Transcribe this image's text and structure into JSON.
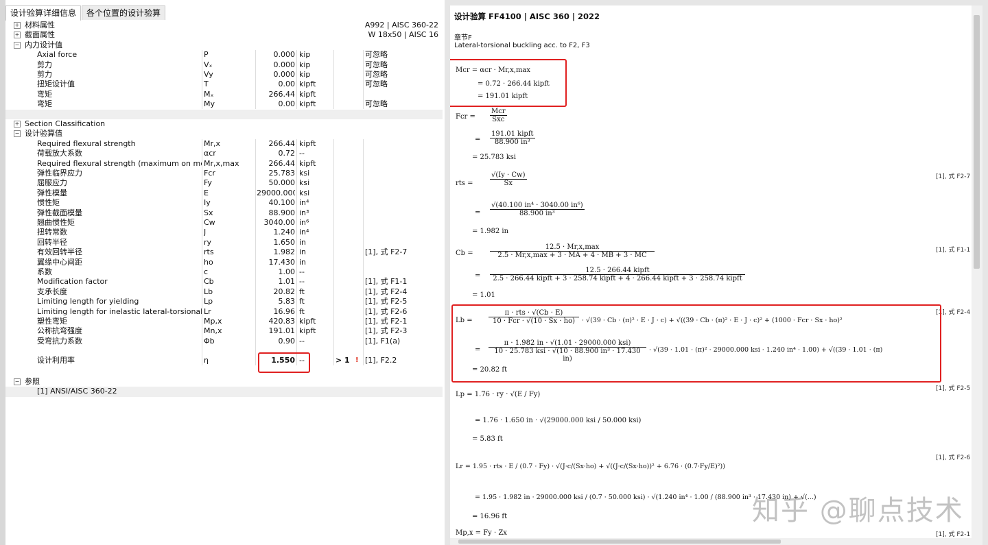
{
  "tabs": [
    "设计验算详细信息",
    "各个位置的设计验算"
  ],
  "tree": {
    "material": {
      "label": "材料属性",
      "value": "A992 | AISC 360-22"
    },
    "section": {
      "label": "截面属性",
      "value": "W 18x50 | AISC 16"
    },
    "internal": {
      "label": "内力设计值",
      "rows": [
        {
          "name": "Axial force",
          "sym": "P",
          "val": "0.000",
          "unit": "kip",
          "ref": "可忽略"
        },
        {
          "name": "剪力",
          "sym": "Vₓ",
          "val": "0.000",
          "unit": "kip",
          "ref": "可忽略"
        },
        {
          "name": "剪力",
          "sym": "Vy",
          "val": "0.000",
          "unit": "kip",
          "ref": "可忽略"
        },
        {
          "name": "扭矩设计值",
          "sym": "T",
          "val": "0.00",
          "unit": "kipft",
          "ref": "可忽略"
        },
        {
          "name": "弯矩",
          "sym": "Mₓ",
          "val": "266.44",
          "unit": "kipft",
          "ref": ""
        },
        {
          "name": "弯矩",
          "sym": "My",
          "val": "0.00",
          "unit": "kipft",
          "ref": "可忽略"
        }
      ]
    },
    "section_class": {
      "label": "Section Classification"
    },
    "design": {
      "label": "设计验算值",
      "rows": [
        {
          "name": "Required flexural strength",
          "sym": "Mr,x",
          "val": "266.44",
          "unit": "kipft",
          "ref": ""
        },
        {
          "name": "荷载放大系数",
          "sym": "αcr",
          "val": "0.72",
          "unit": "--",
          "ref": ""
        },
        {
          "name": "Required flexural strength (maximum on memb...",
          "sym": "Mr,x,max",
          "val": "266.44",
          "unit": "kipft",
          "ref": ""
        },
        {
          "name": "弹性临界应力",
          "sym": "Fcr",
          "val": "25.783",
          "unit": "ksi",
          "ref": ""
        },
        {
          "name": "屈服应力",
          "sym": "Fy",
          "val": "50.000",
          "unit": "ksi",
          "ref": ""
        },
        {
          "name": "弹性模量",
          "sym": "E",
          "val": "29000.000",
          "unit": "ksi",
          "ref": ""
        },
        {
          "name": "惯性矩",
          "sym": "Iy",
          "val": "40.100",
          "unit": "in⁴",
          "ref": ""
        },
        {
          "name": "弹性截面模量",
          "sym": "Sx",
          "val": "88.900",
          "unit": "in³",
          "ref": ""
        },
        {
          "name": "翘曲惯性矩",
          "sym": "Cw",
          "val": "3040.00",
          "unit": "in⁶",
          "ref": ""
        },
        {
          "name": "扭转常数",
          "sym": "J",
          "val": "1.240",
          "unit": "in⁴",
          "ref": ""
        },
        {
          "name": "回转半径",
          "sym": "ry",
          "val": "1.650",
          "unit": "in",
          "ref": ""
        },
        {
          "name": "有效回转半径",
          "sym": "rts",
          "val": "1.982",
          "unit": "in",
          "ref": "[1], 式 F2-7"
        },
        {
          "name": "翼缘中心间距",
          "sym": "ho",
          "val": "17.430",
          "unit": "in",
          "ref": ""
        },
        {
          "name": "系数",
          "sym": "c",
          "val": "1.00",
          "unit": "--",
          "ref": ""
        },
        {
          "name": "Modification factor",
          "sym": "Cb",
          "val": "1.01",
          "unit": "--",
          "ref": "[1], 式 F1-1"
        },
        {
          "name": "支承长度",
          "sym": "Lb",
          "val": "20.82",
          "unit": "ft",
          "ref": "[1], 式 F2-4"
        },
        {
          "name": "Limiting length for yielding",
          "sym": "Lp",
          "val": "5.83",
          "unit": "ft",
          "ref": "[1], 式 F2-5"
        },
        {
          "name": "Limiting length for inelastic lateral-torsional bu...",
          "sym": "Lr",
          "val": "16.96",
          "unit": "ft",
          "ref": "[1], 式 F2-6"
        },
        {
          "name": "塑性弯矩",
          "sym": "Mp,x",
          "val": "420.83",
          "unit": "kipft",
          "ref": "[1], 式 F2-1"
        },
        {
          "name": "公称抗弯强度",
          "sym": "Mn,x",
          "val": "191.01",
          "unit": "kipft",
          "ref": "[1], 式 F2-3"
        },
        {
          "name": "受弯抗力系数",
          "sym": "Φb",
          "val": "0.90",
          "unit": "--",
          "ref": "[1], F1(a)"
        }
      ]
    },
    "ratio": {
      "name": "设计利用率",
      "sym": "η",
      "val": "1.550",
      "unit": "--",
      "cmp": "> 1",
      "ref": "[1], F2.2"
    },
    "refs": {
      "label": "参照",
      "item": "[1]  ANSI/AISC 360-22"
    }
  },
  "report": {
    "title": "设计验算 FF4100 | AISC 360 | 2022",
    "chapter": "章节F",
    "subtitle": "Lateral-torsional buckling acc. to F2, F3",
    "mcr": {
      "l1": "Mcr  =  αcr · Mr,x,max",
      "l2": "=  0.72 · 266.44 kipft",
      "l3": "=  191.01 kipft"
    },
    "fcr": {
      "lhs": "Fcr  =",
      "n1": "Mcr",
      "d1": "Sxc",
      "n2": "191.01 kipft",
      "d2": "88.900 in³",
      "res": "=  25.783 ksi"
    },
    "rts": {
      "lhs": "rts  =",
      "n1": "√(Iy · Cw)",
      "d1": "Sx",
      "n2": "√(40.100 in⁴ · 3040.00 in⁶)",
      "d2": "88.900 in³",
      "res": "=  1.982 in",
      "ref": "[1], 式 F2-7"
    },
    "cb": {
      "lhs": "Cb  =",
      "n1": "12.5 · Mr,x,max",
      "d1": "2.5 · Mr,x,max + 3 · MA + 4 · MB + 3 · MC",
      "n2": "12.5 · 266.44 kipft",
      "d2": "2.5 · 266.44 kipft + 3 · 258.74 kipft + 4 · 266.44 kipft + 3 · 258.74 kipft",
      "res": "=  1.01",
      "ref": "[1], 式 F1-1"
    },
    "lb": {
      "lhs": "Lb  =",
      "n1": "π · rts · √(Cb · E)",
      "d1": "10 · Fcr · √(10 · Sx · ho)",
      "t1": "· √(39 · Cb · (π)² · E · J · c) + √((39 · Cb · (π)² · E · J · c)² + (1000 · Fcr · Sx · ho)²",
      "n2": "π · 1.982 in · √(1.01 · 29000.000 ksi)",
      "d2": "10 · 25.783 ksi · √(10 · 88.900 in³ · 17.430 in)",
      "t2": "· √(39 · 1.01 · (π)² · 29000.000 ksi · 1.240 in⁴ · 1.00) + √((39 · 1.01 · (π)",
      "res": "=  20.82 ft",
      "ref": "[1], 式 F2-4"
    },
    "lp": {
      "l1": "Lp  =  1.76 · ry · √(E / Fy)",
      "l2": "=  1.76 · 1.650 in · √(29000.000 ksi / 50.000 ksi)",
      "res": "=  5.83 ft",
      "ref": "[1], 式 F2-5"
    },
    "lr": {
      "l1": "Lr  =  1.95 · rts · E / (0.7 · Fy) · √(J·c/(Sx·ho) + √((J·c/(Sx·ho))² + 6.76 · (0.7·Fy/E)²))",
      "l2": "=  1.95 · 1.982 in · 29000.000 ksi / (0.7 · 50.000 ksi) · √(1.240 in⁴ · 1.00 / (88.900 in³ · 17.430 in) + √(...)",
      "res": "=  16.96 ft",
      "ref": "[1], 式 F2-6"
    },
    "mp": {
      "l1": "Mp,x  =  Fy · Zx",
      "ref": "[1], 式 F2-1"
    }
  },
  "watermark": "知乎 @聊点技术"
}
